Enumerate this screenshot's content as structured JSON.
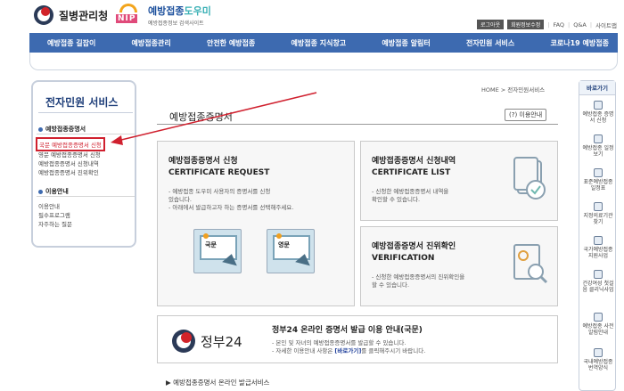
{
  "header": {
    "kdca_logo": "질병관리청",
    "nip_badge": "NIP",
    "nip_title_a": "예방접종",
    "nip_title_b": "도우미",
    "nip_subtitle": "예방접종정보 검색사이트",
    "top_links": {
      "btn1": "로그아웃",
      "btn2": "회원정보수정",
      "faq": "FAQ",
      "qna": "Q&A",
      "sitemap": "사이트맵",
      "sep": "|"
    }
  },
  "nav": {
    "items": [
      "예방접종 길잡이",
      "예방접종관리",
      "안전한 예방접종",
      "예방접종 지식창고",
      "예방접종 알림터",
      "전자민원 서비스",
      "코로나19 예방접종"
    ]
  },
  "sidebar": {
    "title": "전자민원 서비스",
    "section1": "예방접종증명서",
    "items1": [
      "국문 예방접종증명서 신청",
      "영문 예방접종증명서 신청",
      "예방접종증명서 신청내역",
      "예방접종증명서 진위확인"
    ],
    "section2": "이용안내",
    "items2": [
      "이용안내",
      "필수프로그램",
      "자주하는 질문"
    ]
  },
  "content": {
    "breadcrumb": "HOME > 전자민원서비스",
    "title": "예방접종증명서",
    "guide_button": "이용안내",
    "guide_icon": "?",
    "request": {
      "title_ko": "예방접종증명서 신청",
      "title_en": "CERTIFICATE REQUEST",
      "desc1": "- 예방접종 도우미 사용자의 증명서를 신청",
      "desc2": "  있습니다.",
      "desc3": "- 아래에서 발급하고자 하는 증명서를 선택해주세요.",
      "btn_ko": "국문",
      "btn_en": "영문"
    },
    "list": {
      "title_ko": "예방접종증명서 신청내역",
      "title_en": "CERTIFICATE LIST",
      "desc1": "- 신청한 예방접종증명서 내역을",
      "desc2": "  확인할 수 있습니다."
    },
    "verify": {
      "title_ko": "예방접종증명서 진위확인",
      "title_en": "VERIFICATION",
      "desc1": "- 신청한 예방접종증명서의 진위확인을",
      "desc2": "  할 수 있습니다."
    },
    "gov24": {
      "logo_text": "정부24",
      "title": "정부24 온라인 증명서 발급 이용 안내(국문)",
      "desc1": "- 본인 및 자녀의 예방접종증명서를 발급할 수 있습니다.",
      "desc2_pre": "- 자세한 이용안내 사항은 ",
      "desc2_link": "[바로가기]",
      "desc2_post": "를 클릭해주시기 바랍니다."
    },
    "more_link": "▶ 예방접종증명서 온라인 발급서비스"
  },
  "quick": {
    "title": "바로가기",
    "items": [
      "예방접종 증명서 신청",
      "예방접종 일정보기",
      "표준예방접종 일정표",
      "지정의료기관 찾기",
      "국가예방접종 지원사업",
      "건강여성 첫걸음 클리닉사업",
      "예방접종 사전알림안내",
      "국내예방접종 번역양식"
    ]
  },
  "colors": {
    "nav": "#3d6ab0",
    "highlight": "#d0202e"
  }
}
